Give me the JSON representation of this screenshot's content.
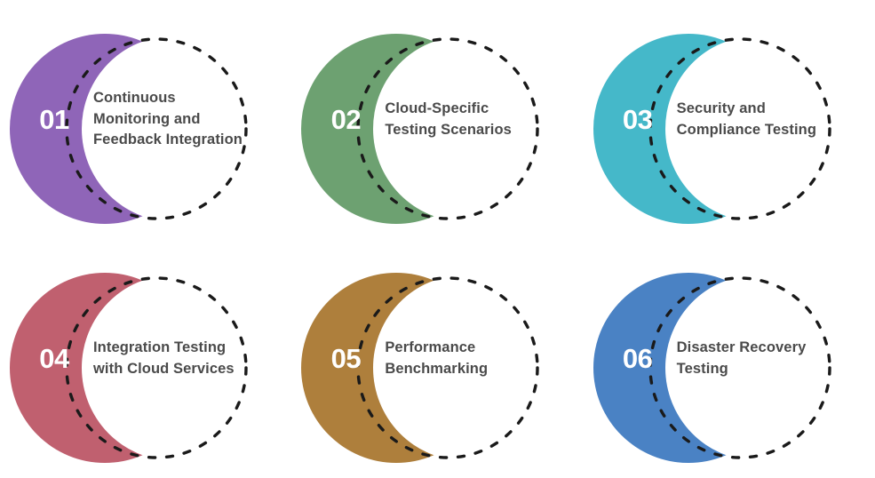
{
  "page": {
    "background_color": "#ffffff",
    "text_color": "#4a4a4a",
    "number_color": "#ffffff",
    "dash_color": "#1a1a1a",
    "columns": 3,
    "rows": 2
  },
  "items": [
    {
      "number": "01",
      "title": "Continuous Monitoring and Feedback Integration",
      "color": "#8f65b8"
    },
    {
      "number": "02",
      "title": "Cloud-Specific Testing Scenarios",
      "color": "#6da171"
    },
    {
      "number": "03",
      "title": "Security and Compliance Testing",
      "color": "#45b8c9"
    },
    {
      "number": "04",
      "title": "Integration Testing with Cloud Services",
      "color": "#c0606f"
    },
    {
      "number": "05",
      "title": "Performance Benchmarking",
      "color": "#ae7f3c"
    },
    {
      "number": "06",
      "title": "Disaster Recovery Testing",
      "color": "#4a82c4"
    }
  ]
}
